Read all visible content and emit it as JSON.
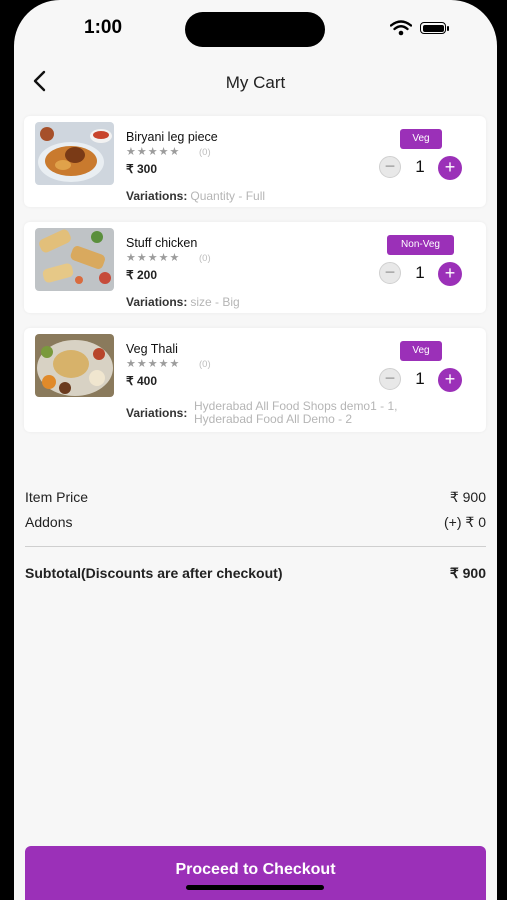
{
  "status": {
    "time": "1:00"
  },
  "header": {
    "title": "My Cart"
  },
  "items": [
    {
      "name": "Biryani leg piece",
      "stars": "★★★★★",
      "rating_count": "(0)",
      "price": "₹ 300",
      "badge": "Veg",
      "qty": "1",
      "variations_label": "Variations:",
      "variations_value": "Quantity - Full"
    },
    {
      "name": "Stuff chicken",
      "stars": "★★★★★",
      "rating_count": "(0)",
      "price": "₹ 200",
      "badge": "Non-Veg",
      "qty": "1",
      "variations_label": "Variations:",
      "variations_value": "size - Big"
    },
    {
      "name": "Veg Thali",
      "stars": "★★★★★",
      "rating_count": "(0)",
      "price": "₹ 400",
      "badge": "Veg",
      "qty": "1",
      "variations_label": "Variations:",
      "variations_value_lines": [
        "Hyderabad All Food Shops demo1 - 1,",
        "Hyderabad Food All Demo - 2"
      ]
    }
  ],
  "summary": {
    "item_price_label": "Item Price",
    "item_price_value": "₹ 900",
    "addons_label": "Addons",
    "addons_value": "(+) ₹ 0",
    "subtotal_label": "Subtotal(Discounts are after checkout)",
    "subtotal_value": "₹ 900"
  },
  "checkout_label": "Proceed to Checkout",
  "colors": {
    "accent": "#9b30b8",
    "background": "#f7f7f7"
  },
  "icons": {
    "back": "chevron-left-icon",
    "wifi": "wifi-icon",
    "battery": "battery-icon",
    "minus": "minus-icon",
    "plus": "plus-icon",
    "star": "star-icon"
  }
}
